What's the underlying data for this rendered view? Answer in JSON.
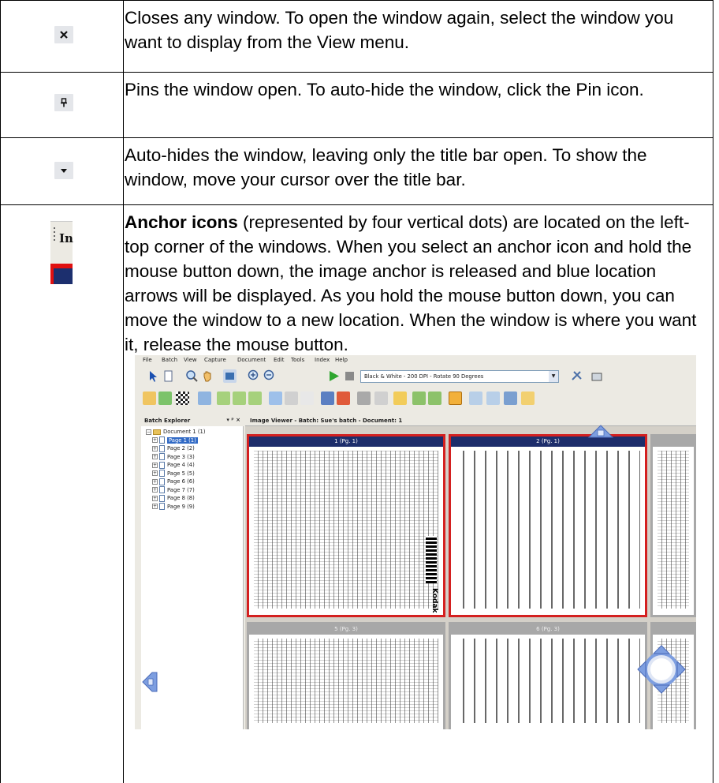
{
  "rows": [
    {
      "icon": "close-icon",
      "glyph": "✕",
      "text": "Closes any window. To open the window again, select the window you want to display from the View menu."
    },
    {
      "icon": "pin-icon",
      "glyph": "ᵖ",
      "text": "Pins the window open. To auto-hide the window, click the Pin icon."
    },
    {
      "icon": "chevron-down-icon",
      "glyph": "▼",
      "text": "Auto-hides the window, leaving only the title bar open. To show the window, move your cursor over the title bar."
    },
    {
      "icon": "anchor-icon",
      "snippet_text": "In",
      "bold": "Anchor icons",
      "text": " (represented by four vertical dots) are located on the left-top corner of the windows. When you select an anchor icon and hold the mouse button down, the image anchor is released and blue location arrows will be displayed. As you hold the mouse button down, you can move the window to a new location. When the window is where you want it, release the mouse button."
    }
  ],
  "screenshot": {
    "menu": [
      "File",
      "Batch",
      "View",
      "Capture",
      "Document",
      "Edit",
      "Tools",
      "Index",
      "Help"
    ],
    "profile_combo": "Black & White - 200 DPI - Rotate 90 Degrees",
    "explorer_title": "Batch Explorer",
    "explorer_controls": "▾ ᵖ ×",
    "tree_root": "Document 1 (1)",
    "tree_pages": [
      "Page 1 (1)",
      "Page 2 (2)",
      "Page 3 (3)",
      "Page 4 (4)",
      "Page 5 (5)",
      "Page 6 (6)",
      "Page 7 (7)",
      "Page 8 (8)",
      "Page 9 (9)"
    ],
    "viewer_title": "Image Viewer - Batch: Sue's batch - Document: 1",
    "thumbs": [
      "1 (Pg. 1)",
      "2 (Pg. 1)",
      "5 (Pg. 3)",
      "6 (Pg. 3)"
    ],
    "kodak_label": "Kodak"
  },
  "colors": {
    "icon_bg": "#e4e6ea",
    "anchor_blue": "#1c2f6e",
    "anchor_red": "#e01010",
    "thumb_header_active": "#1d2d6b",
    "thumb_border_active": "#d42020",
    "thumb_header_inactive": "#a8a8a8",
    "arrow_blue": "#6f8fd6"
  }
}
